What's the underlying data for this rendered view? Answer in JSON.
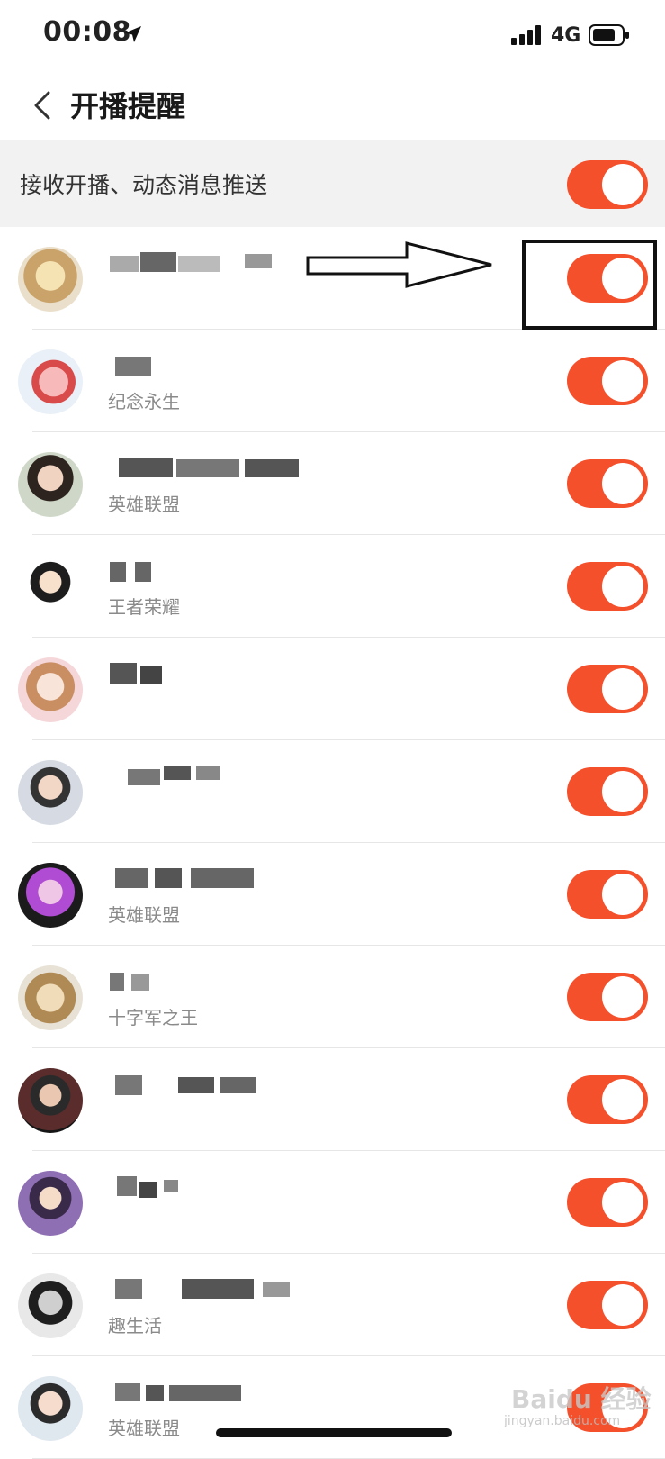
{
  "status_bar": {
    "time": "00:08",
    "network": "4G",
    "icons": [
      "location-arrow-icon",
      "signal-icon",
      "battery-icon"
    ]
  },
  "nav": {
    "back_icon": "chevron-left-icon",
    "title": "开播提醒"
  },
  "master": {
    "label": "接收开播、动态消息推送",
    "enabled": true
  },
  "colors": {
    "toggle_on": "#f4502c",
    "master_bg": "#f2f2f2"
  },
  "list": [
    {
      "subtitle": "",
      "enabled": true
    },
    {
      "subtitle": "纪念永生",
      "enabled": true
    },
    {
      "subtitle": "英雄联盟",
      "enabled": true
    },
    {
      "subtitle": "王者荣耀",
      "enabled": true
    },
    {
      "subtitle": "",
      "enabled": true
    },
    {
      "subtitle": "",
      "enabled": true
    },
    {
      "subtitle": "英雄联盟",
      "enabled": true
    },
    {
      "subtitle": "十字军之王",
      "enabled": true
    },
    {
      "subtitle": "",
      "enabled": true
    },
    {
      "subtitle": "",
      "enabled": true
    },
    {
      "subtitle": "趣生活",
      "enabled": true
    },
    {
      "subtitle": "英雄联盟",
      "enabled": true
    }
  ],
  "watermark": {
    "brand": "Baidu 经验",
    "url": "jingyan.baidu.com"
  }
}
